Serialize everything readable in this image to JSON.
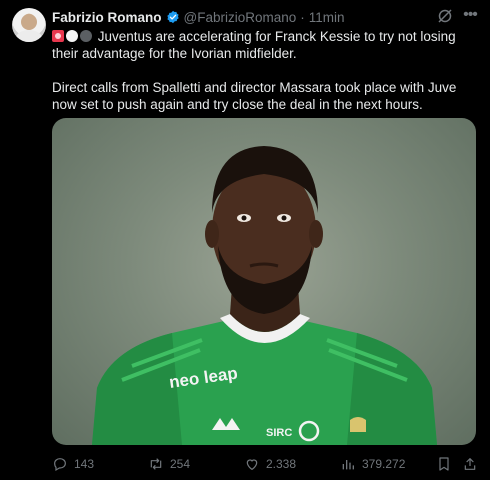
{
  "author": {
    "name": "Fabrizio Romano",
    "handle": "@FabrizioRomano",
    "separator": "·",
    "time": "11min"
  },
  "icons": {
    "verified": "verified-badge-icon",
    "grok": "grok-icon",
    "more": "more-icon",
    "reply": "reply-icon",
    "retweet": "retweet-icon",
    "like": "heart-icon",
    "views": "views-icon",
    "bookmark": "bookmark-icon",
    "share": "share-icon"
  },
  "tweet": {
    "line1": "Juventus are accelerating for Franck Kessie to try not losing their advantage for the Ivorian midfielder.",
    "line2": "Direct calls from Spalletti and director Massara took place with Juve now set to push again and try close the deal in the next hours."
  },
  "media": {
    "sponsor_logo": "neo leap",
    "kit_text": "SIRC"
  },
  "stats": {
    "replies": "143",
    "retweets": "254",
    "likes": "2.338",
    "views": "379.272"
  },
  "colors": {
    "background": "#000000",
    "text": "#e7e9ea",
    "muted": "#71767b",
    "verified": "#1d9bf0",
    "jersey": "#2aa14f"
  }
}
